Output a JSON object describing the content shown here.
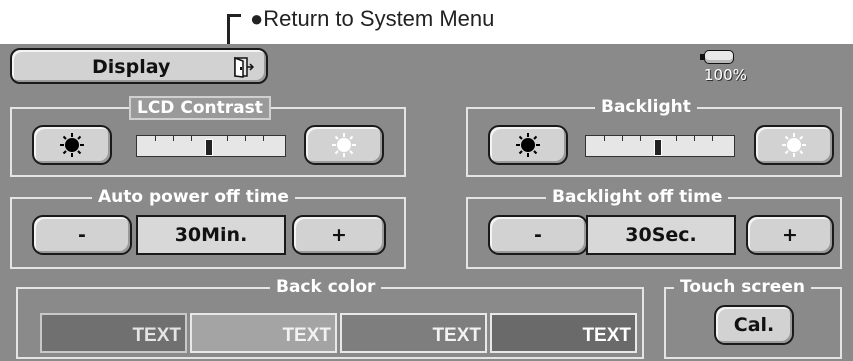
{
  "annotation": {
    "text": "●Return to System Menu"
  },
  "header": {
    "title": "Display",
    "door_icon": "door-exit-icon",
    "battery_percent": "100%",
    "battery_level": 1.0
  },
  "lcd_contrast": {
    "title": "LCD Contrast",
    "level": 0.5,
    "dark_icon": "sun-dark-icon",
    "bright_icon": "sun-bright-icon"
  },
  "backlight": {
    "title": "Backlight",
    "level": 0.5,
    "dark_icon": "sun-dark-icon",
    "bright_icon": "sun-bright-icon"
  },
  "auto_power_off": {
    "title": "Auto power off time",
    "minus": "-",
    "value": "30Min.",
    "plus": "+"
  },
  "backlight_off": {
    "title": "Backlight off time",
    "minus": "-",
    "value": "30Sec.",
    "plus": "+"
  },
  "back_color": {
    "title": "Back color",
    "options": [
      {
        "label": "TEXT",
        "color": "#707070"
      },
      {
        "label": "TEXT",
        "color": "#a4a4a4"
      },
      {
        "label": "TEXT",
        "color": "#7e7e7e"
      },
      {
        "label": "TEXT",
        "color": "#6a6a6a"
      }
    ]
  },
  "touch_screen": {
    "title": "Touch screen",
    "button": "Cal."
  },
  "colors": {
    "screen_bg": "#8a8a8a",
    "button_bg": "#d2d2d2",
    "frame": "#e4e4e4"
  }
}
